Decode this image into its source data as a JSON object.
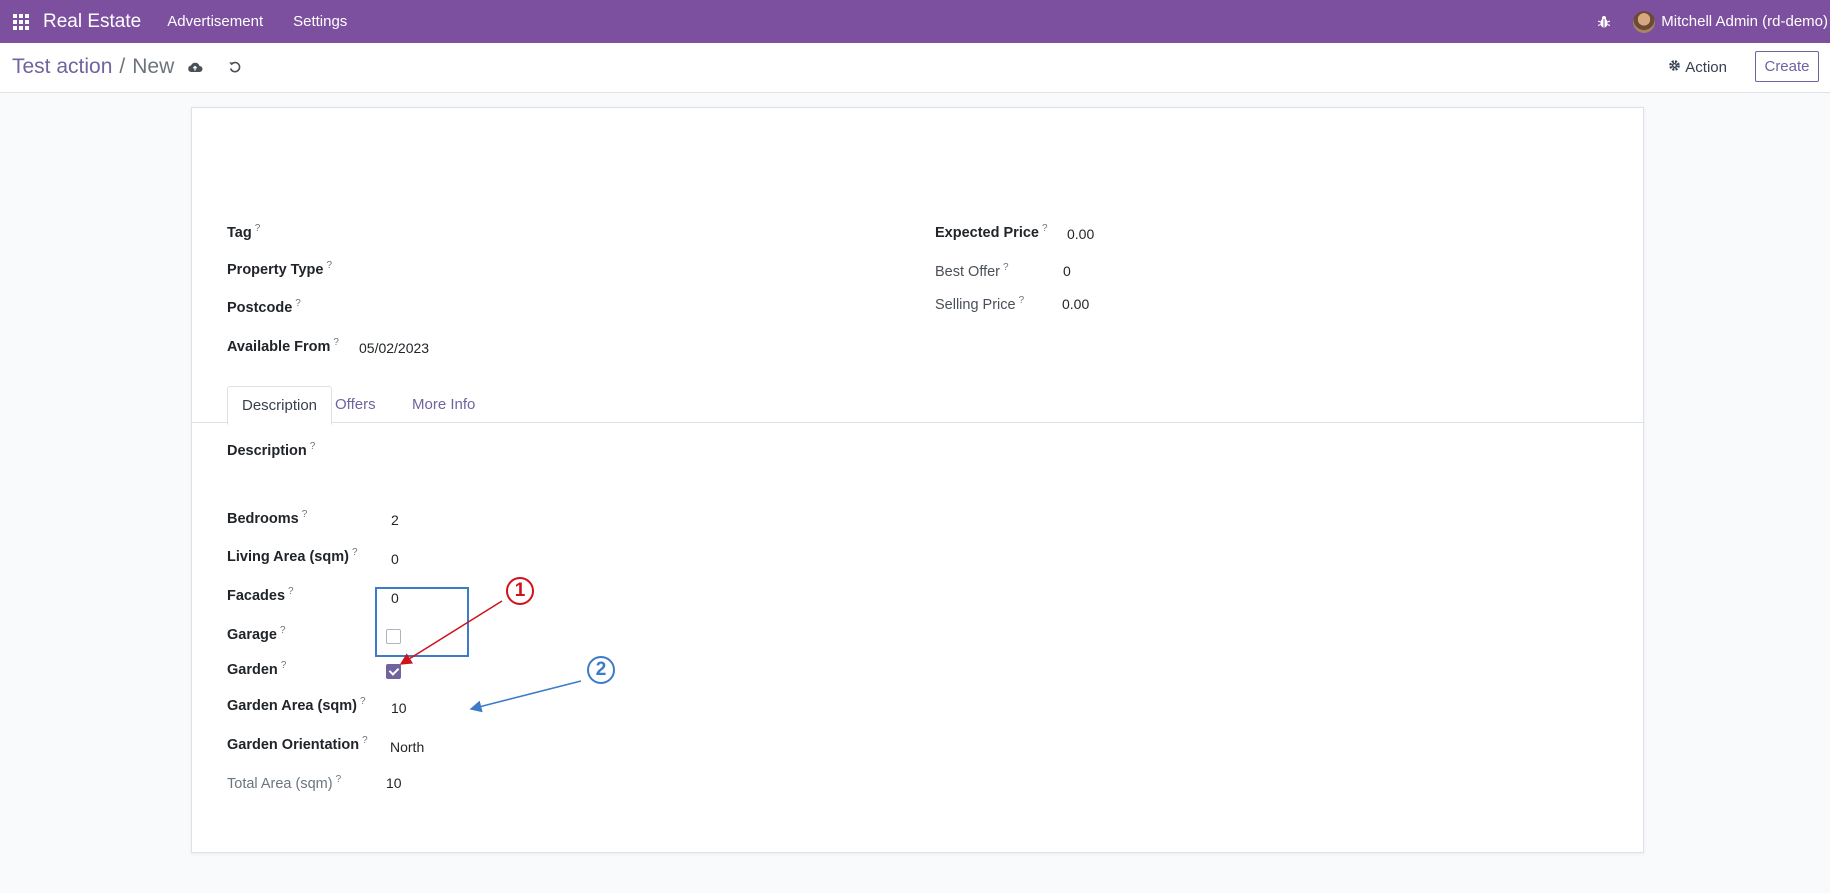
{
  "navbar": {
    "brand": "Real Estate",
    "menu": [
      "Advertisement",
      "Settings"
    ],
    "user": "Mitchell Admin (rd-demo)",
    "icons": [
      "apps-grid-icon",
      "bug-icon",
      "avatar"
    ],
    "color": "#7c4f9f"
  },
  "control_panel": {
    "breadcrumb_parent": "Test action",
    "breadcrumb_separator": "/",
    "breadcrumb_current": "New",
    "action_label": "Action",
    "create_label": "Create"
  },
  "form": {
    "left": {
      "tag_label": "Tag",
      "property_type_label": "Property Type",
      "postcode_label": "Postcode",
      "available_from_label": "Available From",
      "available_from_value": "05/02/2023"
    },
    "right": {
      "expected_price_label": "Expected Price",
      "expected_price_value": "0.00",
      "best_offer_label": "Best Offer",
      "best_offer_value": "0",
      "selling_price_label": "Selling Price",
      "selling_price_value": "0.00"
    },
    "help_marker": "?",
    "tabs": [
      "Description",
      "Offers",
      "More Info"
    ],
    "description": {
      "description_label": "Description",
      "bedrooms_label": "Bedrooms",
      "bedrooms_value": "2",
      "living_area_label": "Living Area (sqm)",
      "living_area_value": "0",
      "facades_label": "Facades",
      "facades_value": "0",
      "garage_label": "Garage",
      "garage_checked": false,
      "garden_label": "Garden",
      "garden_checked": true,
      "garden_area_label": "Garden Area (sqm)",
      "garden_area_value": "10",
      "garden_orientation_label": "Garden Orientation",
      "garden_orientation_value": "North",
      "total_area_label": "Total Area (sqm)",
      "total_area_value": "10"
    }
  },
  "annotations": {
    "marker_1": "1",
    "marker_2": "2",
    "marker_1_color": "#d0121b",
    "marker_2_color": "#3d7bc8"
  }
}
